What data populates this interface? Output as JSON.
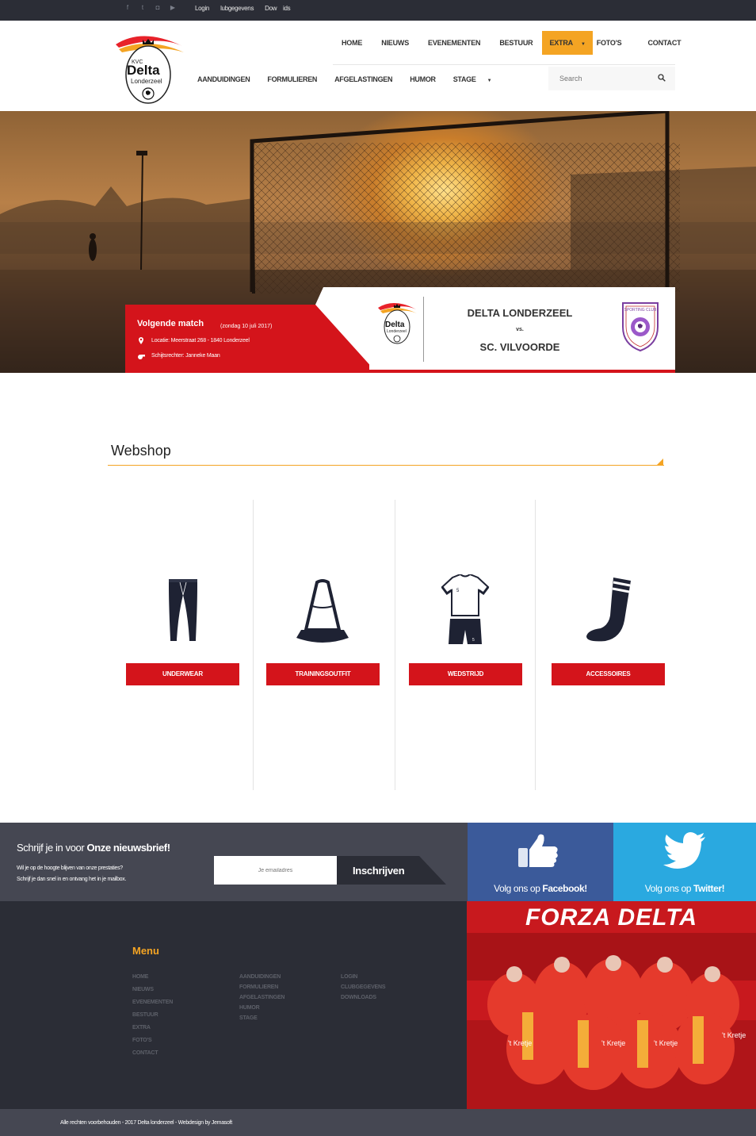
{
  "topbar": {
    "social_icons": [
      "facebook-icon",
      "twitter-icon",
      "instagram-icon",
      "youtube-icon"
    ],
    "links": [
      "Login",
      "lubgegevens",
      "Dow",
      "ids"
    ]
  },
  "logo": {
    "top": "KVC",
    "name": "Delta",
    "city": "Londerzeel"
  },
  "nav_main": [
    "HOME",
    "NIEUWS",
    "EVENEMENTEN",
    "BESTUUR",
    "EXTRA",
    "FOTO'S",
    "CONTACT"
  ],
  "nav_active": "EXTRA",
  "nav_sub": [
    "AANDUIDINGEN",
    "FORMULIEREN",
    "AFGELASTINGEN",
    "HUMOR",
    "STAGE"
  ],
  "search": {
    "placeholder": "Search"
  },
  "match": {
    "title": "Volgende match",
    "date": "(zondag 10 juli 2017)",
    "location": "Locatie: Meerstraat 268 - 1840 Londerzeel",
    "referee": "Schijtsrechter: Janneke Maan",
    "home": "DELTA LONDERZEEL",
    "vs": "vs.",
    "away": "SC. VILVOORDE",
    "away_logo_text": "SPORTING CLUB"
  },
  "webshop": {
    "title": "Webshop",
    "items": [
      {
        "label": "UNDERWEAR",
        "icon": "leggings-icon"
      },
      {
        "label": "TRAININGSOUTFIT",
        "icon": "cone-icon"
      },
      {
        "label": "WEDSTRIJD",
        "icon": "kit-icon"
      },
      {
        "label": "ACCESSOIRES",
        "icon": "sock-icon"
      }
    ]
  },
  "newsletter": {
    "heading_pre": "Schrijf je in voor ",
    "heading_bold": "Onze nieuwsbrief!",
    "line1": "Wil je op de hoogte blijven van onze prestaties?",
    "line2": "Schrijf je dan snel in en ontvang het in je mailbox.",
    "placeholder": "Je emailadres",
    "button": "Inschrijven"
  },
  "social_blocks": {
    "fb_pre": "Volg ons op ",
    "fb_bold": "Facebook!",
    "tw_pre": "Volg ons op ",
    "tw_bold": "Twitter!"
  },
  "footer": {
    "menu_title": "Menu",
    "col1": [
      "HOME",
      "NIEUWS",
      "EVENEMENTEN",
      "BESTUUR",
      "EXTRA",
      "FOTO'S",
      "CONTACT"
    ],
    "col2": [
      "AANDUIDINGEN",
      "FORMULIEREN",
      "AFGELASTINGEN",
      "HUMOR",
      "STAGE"
    ],
    "col3": [
      "LOGIN",
      "CLUBGEGEVENS",
      "DOWNLOADS"
    ],
    "forza": "FORZA DELTA",
    "shirt_text": "'t Kretje",
    "copyright": "Alle rechten voorbehouden - 2017 Delta londerzeel - Webdesign by Jemasoft"
  },
  "colors": {
    "accent": "#f4a423",
    "red": "#d4141b",
    "dark": "#2b2d36",
    "fb": "#3b5a9a",
    "tw": "#2aa9e0"
  }
}
